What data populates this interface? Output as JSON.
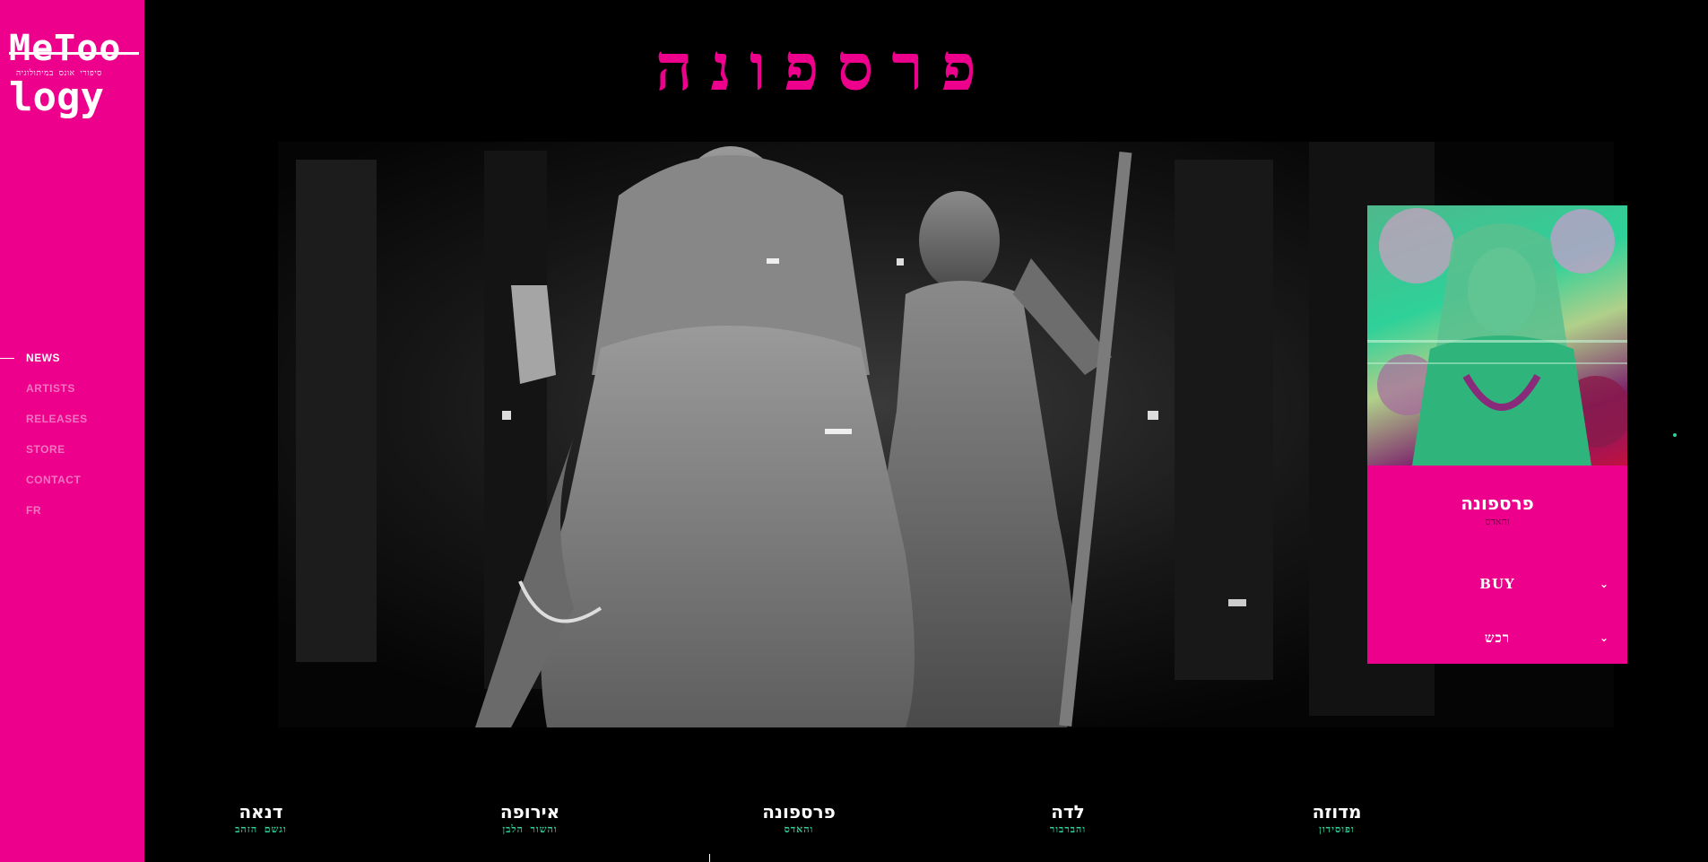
{
  "brand": {
    "logo_line1": "MeToo",
    "logo_subtitle": "סיפורי אונס במיתולוגיה",
    "logo_line2": "logy",
    "pink": "#ec008c",
    "green": "#2ed199"
  },
  "nav": {
    "items": [
      {
        "label": "NEWS",
        "active": true
      },
      {
        "label": "ARTISTS",
        "active": false
      },
      {
        "label": "RELEASES",
        "active": false
      },
      {
        "label": "STORE",
        "active": false
      },
      {
        "label": "CONTACT",
        "active": false
      },
      {
        "label": "FR",
        "active": false
      }
    ]
  },
  "page": {
    "title": "פרספונה"
  },
  "card": {
    "title": "פרספונה",
    "subtitle": "והאדס",
    "buy_label": "BUY",
    "buy_he_label": "רכש",
    "chevron_icon": "chevron-down-icon"
  },
  "stories": [
    {
      "name": "מדוזה",
      "with": "ופוסידון"
    },
    {
      "name": "לדה",
      "with": "והברבור"
    },
    {
      "name": "פרספונה",
      "with": "והאדס"
    },
    {
      "name": "אירופה",
      "with": "והשור הלבן"
    },
    {
      "name": "דנאה",
      "with": "וגשם הזהב"
    }
  ]
}
